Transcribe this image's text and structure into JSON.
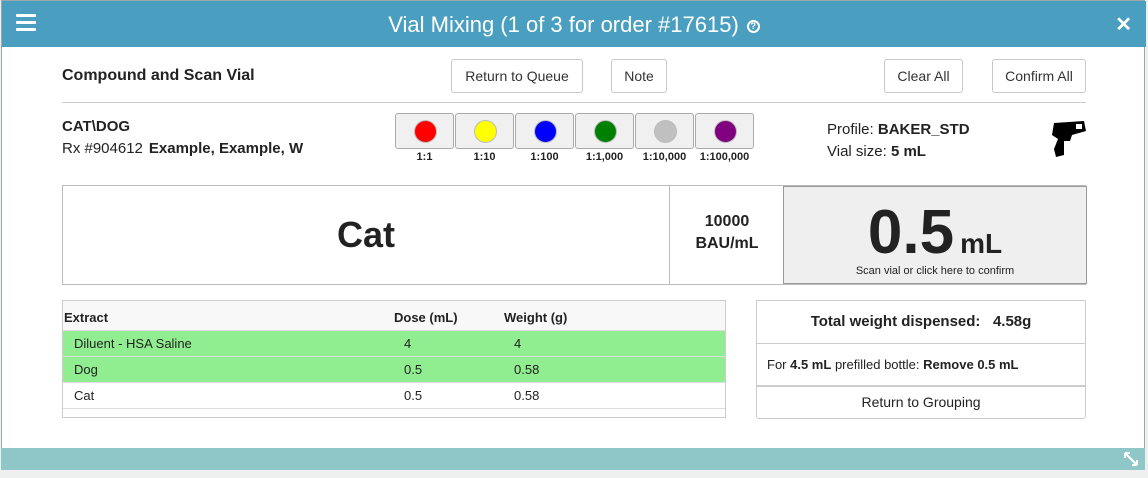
{
  "window": {
    "title": "Vial Mixing (1 of 3 for order #17615)",
    "help_glyph": "?",
    "close_glyph": "✕"
  },
  "header": {
    "title": "Compound and Scan Vial",
    "return_queue": "Return to Queue",
    "note": "Note",
    "clear_all": "Clear All",
    "confirm_all": "Confirm All"
  },
  "patient": {
    "name": "CAT\\DOG",
    "rx": "Rx #904612",
    "rx_name": "Example, Example, W"
  },
  "dilutions": [
    {
      "label": "1:1",
      "color": "#ff0000"
    },
    {
      "label": "1:10",
      "color": "#ffff00"
    },
    {
      "label": "1:100",
      "color": "#0000ff"
    },
    {
      "label": "1:1,000",
      "color": "#008000"
    },
    {
      "label": "1:10,000",
      "color": "#c0c0c0"
    },
    {
      "label": "1:100,000",
      "color": "#800080"
    }
  ],
  "profile": {
    "profile_label": "Profile:",
    "profile_value": "BAKER_STD",
    "vial_label": "Vial size:",
    "vial_value": "5 mL"
  },
  "mix": {
    "extract": "Cat",
    "conc_value": "10000",
    "conc_unit": "BAU/mL",
    "volume": "0.5",
    "volume_unit": "mL",
    "hint": "Scan vial or click here to confirm"
  },
  "table": {
    "headers": [
      "Extract",
      "Dose (mL)",
      "Weight (g)"
    ],
    "rows": [
      {
        "extract": "Diluent - HSA Saline",
        "dose": "4",
        "weight": "4",
        "highlight": true
      },
      {
        "extract": "Dog",
        "dose": "0.5",
        "weight": "0.58",
        "highlight": true
      },
      {
        "extract": "Cat",
        "dose": "0.5",
        "weight": "0.58",
        "highlight": false
      }
    ]
  },
  "totals": {
    "label": "Total weight dispensed:",
    "value": "4.58g",
    "prefill_pre": "For",
    "prefill_vol": "4.5 mL",
    "prefill_mid": "prefilled bottle:",
    "prefill_action": "Remove 0.5 mL",
    "return_grouping": "Return to Grouping"
  },
  "colors": {
    "title_bar": "#4a9fc0",
    "highlight_row": "#90ee90",
    "footer": "#8fc7c9"
  }
}
